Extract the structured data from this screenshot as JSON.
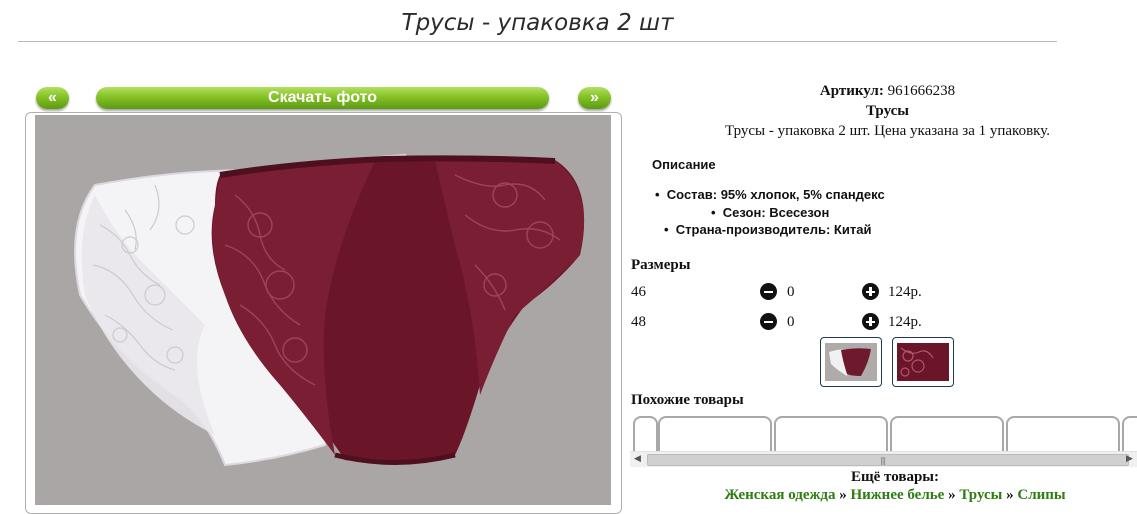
{
  "product": {
    "title": "Трусы - упаковка 2 шт",
    "article_label": "Артикул:",
    "article_value": "961666238",
    "name": "Трусы",
    "short_desc": "Трусы - упаковка 2 шт. Цена указана за 1 упаковку."
  },
  "gallery": {
    "prev_label": "«",
    "next_label": "»",
    "download_label": "Скачать фото",
    "photo_icon": "product-photo"
  },
  "description": {
    "heading": "Описание",
    "features": [
      "Состав: 95% хлопок, 5% спандекс",
      "Сезон: Всесезон",
      "Страна-производитель: Китай"
    ]
  },
  "sizes": {
    "heading": "Размеры",
    "rows": [
      {
        "size": "46",
        "qty": "0",
        "price": "124р."
      },
      {
        "size": "48",
        "qty": "0",
        "price": "124р."
      }
    ]
  },
  "similar": {
    "heading": "Похожие товары"
  },
  "more": {
    "heading": "Ещё товары:",
    "breadcrumbs": [
      "Женская одежда",
      "Нижнее белье",
      "Трусы",
      "Слипы"
    ],
    "separator": "»"
  },
  "colors": {
    "accent_green": "#7cb82f",
    "link_green": "#2e7d12",
    "burgundy": "#6b1a2a",
    "photo_bg": "#aba6a6"
  }
}
